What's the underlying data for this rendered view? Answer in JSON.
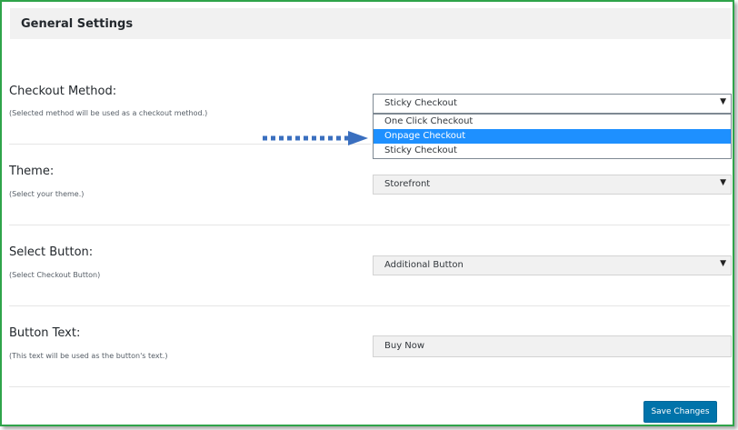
{
  "header": {
    "title": "General Settings"
  },
  "rows": {
    "checkout_method": {
      "label": "Checkout Method:",
      "description": "(Selected method will be used as a checkout method.)",
      "value": "Sticky Checkout",
      "options": [
        "One Click Checkout",
        "Onpage Checkout",
        "Sticky Checkout"
      ],
      "highlighted_option": "Onpage Checkout"
    },
    "theme": {
      "label": "Theme:",
      "description": "(Select your theme.)",
      "value": "Storefront"
    },
    "select_button": {
      "label": "Select Button:",
      "description": "(Select Checkout Button)",
      "value": "Additional Button"
    },
    "button_text": {
      "label": "Button Text:",
      "description": "(This text will be used as the button's text.)",
      "value": "Buy Now"
    }
  },
  "footer": {
    "save_label": "Save Changes"
  },
  "icons": {
    "caret": "dropdown-caret-icon",
    "arrow": "dotted-arrow-icon"
  },
  "colors": {
    "accent": "#0073aa",
    "highlight": "#1e90ff",
    "frame": "#2fa44a",
    "arrow": "#3a6fbf"
  }
}
